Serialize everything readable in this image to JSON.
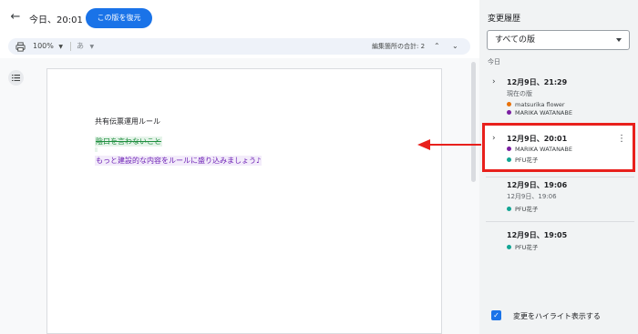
{
  "header": {
    "back_icon": "arrow-left-icon",
    "version_title": "今日、20:01",
    "restore_label": "この版を復元"
  },
  "toolbar": {
    "print_icon": "printer-icon",
    "zoom": "100%",
    "text_style": "あ",
    "edit_count_label": "編集箇所の合計: 2"
  },
  "document": {
    "title": "共有伝票運用ルール",
    "deleted_line": "陰口を言わないこと",
    "added_line": "もっと建設的な内容をルールに盛り込みましょう♪"
  },
  "panel": {
    "title": "変更履歴",
    "filter_value": "すべての版",
    "section_today": "今日",
    "highlight_label": "変更をハイライト表示する",
    "highlight_checked": true,
    "entries": [
      {
        "time": "12月9日、21:29",
        "sub": "現在の版",
        "people": [
          {
            "name": "matsurika flower",
            "color": "#e8710a"
          },
          {
            "name": "MARIKA WATANABE",
            "color": "#7b1fa2"
          }
        ]
      },
      {
        "time": "12月9日、20:01",
        "people": [
          {
            "name": "MARIKA WATANABE",
            "color": "#7b1fa2"
          },
          {
            "name": "PFU花子",
            "color": "#12a594"
          }
        ]
      },
      {
        "time": "12月9日、19:06",
        "sub": "12月9日、19:06",
        "people": [
          {
            "name": "PFU花子",
            "color": "#12a594"
          }
        ]
      },
      {
        "time": "12月9日、19:05",
        "people": [
          {
            "name": "PFU花子",
            "color": "#12a594"
          }
        ]
      }
    ]
  },
  "colors": {
    "accent": "#1a73e8",
    "highlight_frame": "#e8201c",
    "deleted": "#1e8e3e",
    "added": "#6c1fb5"
  }
}
